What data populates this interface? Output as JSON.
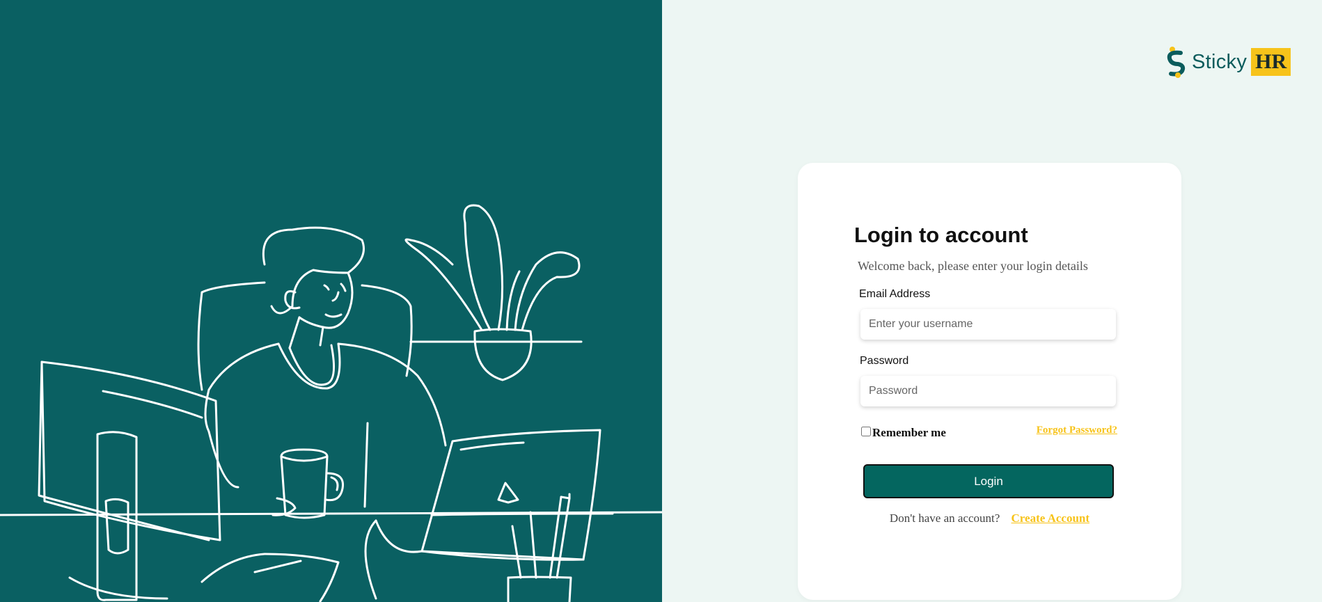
{
  "brand": {
    "name": "Sticky",
    "badge": "HR",
    "colors": {
      "primary": "#0a6062",
      "accent": "#f7c31a",
      "background": "#edf6f3"
    }
  },
  "illustration": {
    "icon": "person-at-desk-illustration"
  },
  "login": {
    "title": "Login to account",
    "subtitle": "Welcome back, please enter your login details",
    "email_label": "Email Address",
    "email_placeholder": "Enter your username",
    "password_label": "Password",
    "password_placeholder": "Password",
    "remember_label": "Remember me",
    "forgot_label": "Forgot Password?",
    "button_label": "Login",
    "signup_text": "Don't have an account?",
    "signup_link": "Create Account"
  }
}
